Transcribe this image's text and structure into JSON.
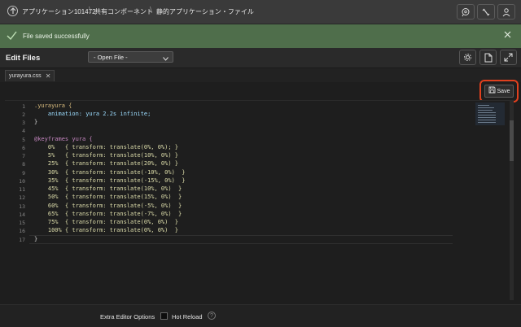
{
  "breadcrumb": {
    "items": [
      "アプリケーション101472",
      "共有コンポーネント",
      "静的アプリケーション・ファイル"
    ]
  },
  "topbar_icons": [
    "search-chat-icon",
    "wrench-icon",
    "person-icon"
  ],
  "alert": {
    "message": "File saved successfully"
  },
  "header": {
    "title": "Edit Files",
    "file_select": "- Open File -",
    "icons": [
      "gear-icon",
      "file-icon",
      "expand-icon"
    ]
  },
  "tab": {
    "name": "yurayura.css",
    "close": "✕"
  },
  "save_button": {
    "label": "Save"
  },
  "editor": {
    "line_numbers": [
      "1",
      "2",
      "3",
      "4",
      "5",
      "6",
      "7",
      "8",
      "9",
      "10",
      "11",
      "12",
      "13",
      "14",
      "15",
      "16",
      "17"
    ],
    "lines": [
      ".yurayura {",
      "    animation: yura 2.2s infinite;",
      "}",
      "",
      "@keyframes yura {",
      "    0%   { transform: translate(0%, 0%); }",
      "    5%   { transform: translate(10%, 0%) }",
      "    25%  { transform: translate(20%, 0%) }",
      "    30%  { transform: translate(-10%, 0%)  }",
      "    35%  { transform: translate(-15%, 0%)  }",
      "    45%  { transform: translate(10%, 0%)  }",
      "    50%  { transform: translate(15%, 0%)  }",
      "    60%  { transform: translate(-5%, 0%)  }",
      "    65%  { transform: translate(-7%, 0%)  }",
      "    75%  { transform: translate(0%, 0%)  }",
      "    100% { transform: translate(0%, 0%)  }",
      "}"
    ]
  },
  "footer": {
    "extra_options": "Extra Editor Options",
    "hot_reload": "Hot Reload",
    "help": "?"
  },
  "colors": {
    "alert_bg": "#4f6e4b",
    "highlight_ring": "#e0401e",
    "selector": "#d7ba7d",
    "keyword": "#c586c0",
    "property": "#9cdcfe"
  }
}
